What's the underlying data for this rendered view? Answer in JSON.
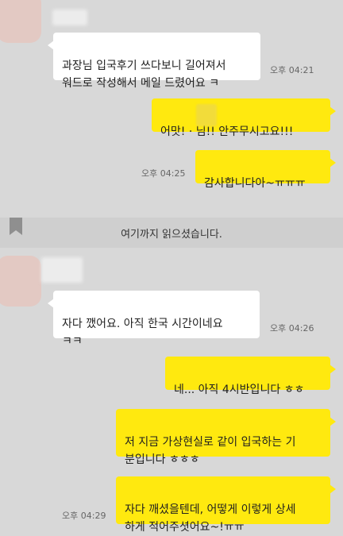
{
  "theme": {
    "background": "#d8d8d8",
    "incoming_bubble": "#ffffff",
    "outgoing_bubble": "#ffe90f",
    "divider": "#cfcfcf"
  },
  "messages": [
    {
      "direction": "incoming",
      "text": "과장님 입국후기 쓰다보니 길어져서\n워드로 작성해서 메일 드렸어요 ㅋ",
      "time": "오후 04:21"
    },
    {
      "direction": "outgoing",
      "text": "어맛! ·     님!! 안주무시고요!!!",
      "time": ""
    },
    {
      "direction": "outgoing",
      "text": "감사합니다아~ㅠㅠㅠ",
      "time": "오후 04:25"
    },
    {
      "direction": "incoming",
      "text": "자다 깼어요. 아직 한국 시간이네요\nㅋㅋ",
      "time": "오후 04:26"
    },
    {
      "direction": "outgoing",
      "text": "네... 아직 4시반입니다 ㅎㅎ",
      "time": ""
    },
    {
      "direction": "outgoing",
      "text": "저 지금 가상현실로 같이 입국하는 기\n분입니다 ㅎㅎㅎ",
      "time": ""
    },
    {
      "direction": "outgoing",
      "text": "자다 깨셨을텐데, 어떻게 이렇게 상세\n하게 적어주셧어요~!ㅠㅠ",
      "time": "오후 04:29"
    }
  ],
  "divider": {
    "text": "여기까지 읽으셨습니다.",
    "icon": "bookmark-icon"
  }
}
